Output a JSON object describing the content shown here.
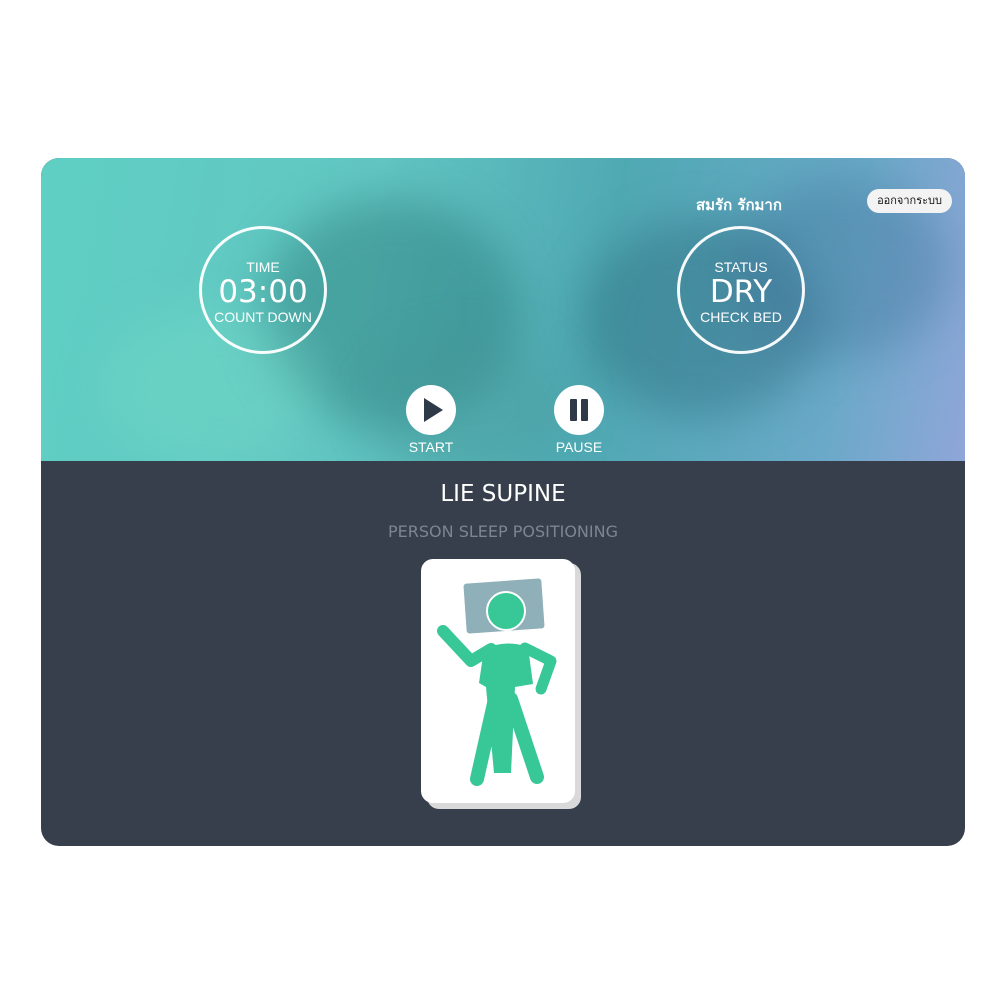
{
  "header": {
    "user_name": "สมรัก รักมาก",
    "logout_label": "ออกจากระบบ"
  },
  "timer": {
    "top_label": "TIME",
    "value": "03:00",
    "bottom_label": "COUNT DOWN"
  },
  "status": {
    "top_label": "STATUS",
    "value": "DRY",
    "bottom_label": "CHECK BED"
  },
  "controls": {
    "start_label": "START",
    "pause_label": "PAUSE"
  },
  "position": {
    "title": "LIE SUPINE",
    "subtitle": "PERSON SLEEP POSITIONING"
  },
  "icons": {
    "start": "play-icon",
    "pause": "pause-icon",
    "illustration": "person-supine-bed-icon"
  },
  "colors": {
    "accent_green": "#38c796",
    "panel_dark": "#363f4b",
    "pillow": "#8fb0b8"
  }
}
